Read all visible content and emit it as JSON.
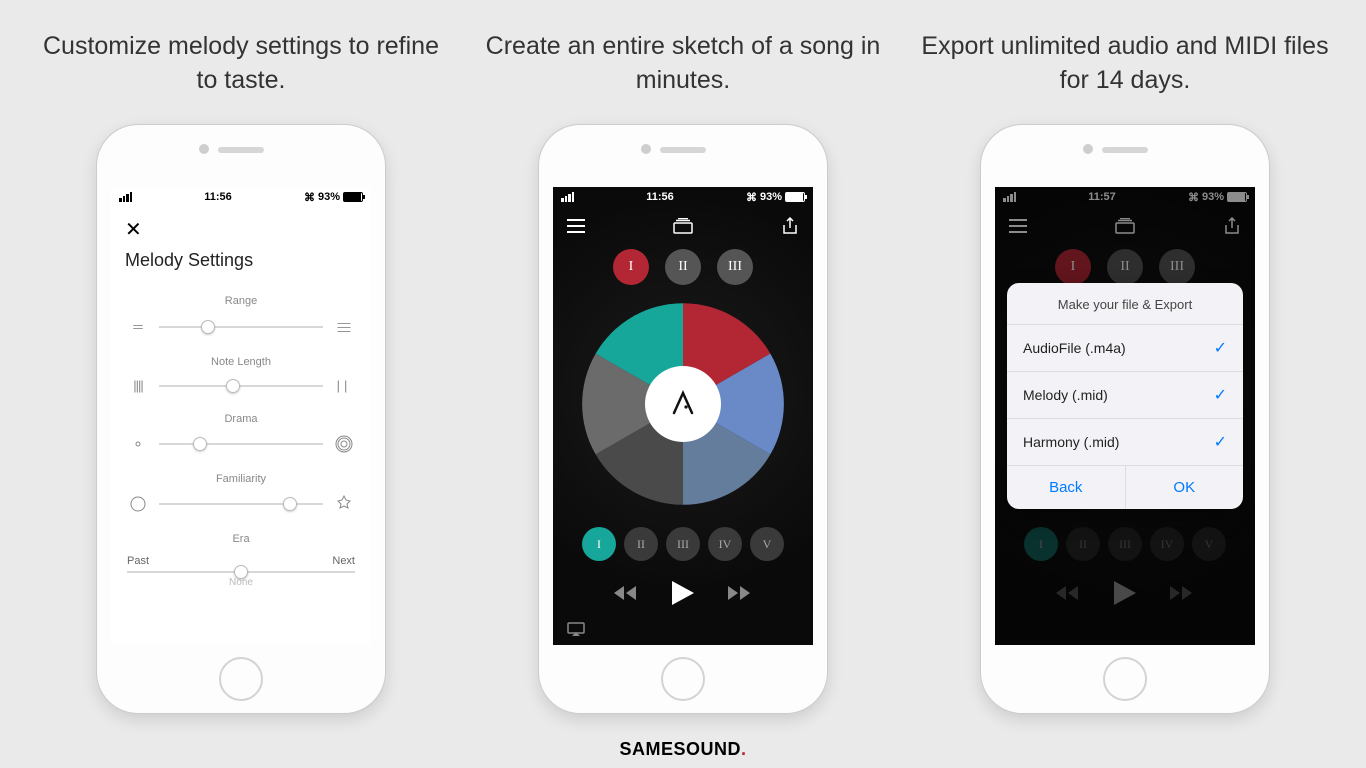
{
  "captions": {
    "c1": "Customize melody settings to refine to taste.",
    "c2": "Create an entire sketch of a song in minutes.",
    "c3": "Export unlimited audio and MIDI files for 14 days."
  },
  "statusbar": {
    "time1": "11:56",
    "time2": "11:56",
    "time3": "11:57",
    "battery": "93%"
  },
  "screen1": {
    "title": "Melody Settings",
    "settings": {
      "range": {
        "label": "Range",
        "value": 30
      },
      "noteLength": {
        "label": "Note Length",
        "value": 45
      },
      "drama": {
        "label": "Drama",
        "value": 25
      },
      "familiarity": {
        "label": "Familiarity",
        "value": 80
      },
      "era": {
        "label": "Era",
        "left": "Past",
        "right": "Next",
        "sub": "None",
        "value": 50
      }
    }
  },
  "screen2": {
    "topRoman": [
      "I",
      "II",
      "III"
    ],
    "topActive": 0,
    "wheelColors": [
      "#b22733",
      "#6a8ac7",
      "#647d9d",
      "#4a4a4a",
      "#6b6b6b",
      "#17a79a"
    ],
    "bottomRoman": [
      "I",
      "II",
      "III",
      "IV",
      "V"
    ],
    "bottomActive": 0
  },
  "screen3": {
    "sheetTitle": "Make your file & Export",
    "options": [
      {
        "label": "AudioFile (.m4a)",
        "checked": true
      },
      {
        "label": "Melody (.mid)",
        "checked": true
      },
      {
        "label": "Harmony (.mid)",
        "checked": true
      }
    ],
    "back": "Back",
    "ok": "OK"
  },
  "watermark": "SAMESOUND"
}
